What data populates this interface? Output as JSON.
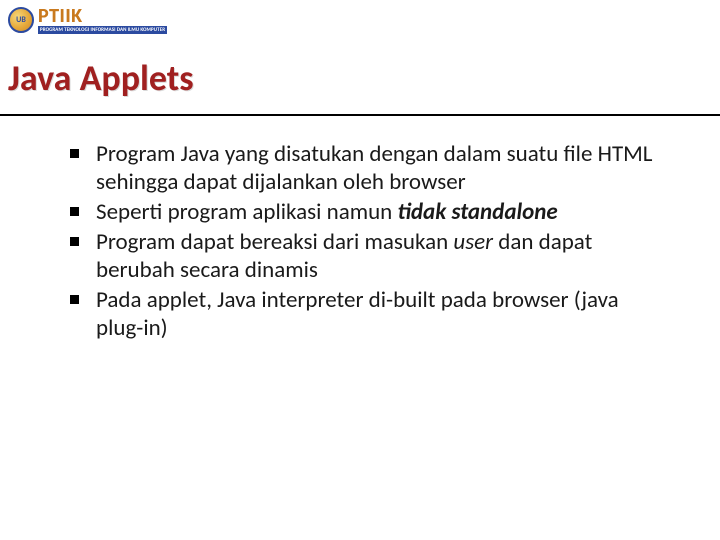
{
  "logo": {
    "main": "PTIIK",
    "sub": "PROGRAM TEKNOLOGI INFORMASI DAN ILMU KOMPUTER"
  },
  "title": "Java Applets",
  "bullets": [
    {
      "pre": "Program Java yang disatukan dengan dalam suatu file HTML sehingga dapat dijalankan oleh browser",
      "bold": "",
      "post": ""
    },
    {
      "pre": "Seperti program aplikasi namun ",
      "bold": "tidak standalone",
      "post": ""
    },
    {
      "pre": "Program dapat bereaksi dari masukan ",
      "bold": "",
      "italic": "user",
      "post": " dan dapat berubah secara dinamis"
    },
    {
      "pre": "Pada applet, Java interpreter di-built pada browser (java plug-in)",
      "bold": "",
      "post": ""
    }
  ]
}
